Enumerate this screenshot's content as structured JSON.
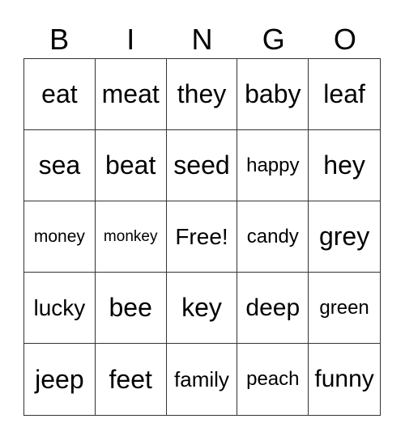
{
  "header": [
    "B",
    "I",
    "N",
    "G",
    "O"
  ],
  "cells": [
    "eat",
    "meat",
    "they",
    "baby",
    "leaf",
    "sea",
    "beat",
    "seed",
    "happy",
    "hey",
    "money",
    "monkey",
    "Free!",
    "candy",
    "grey",
    "lucky",
    "bee",
    "key",
    "deep",
    "green",
    "jeep",
    "feet",
    "family",
    "peach",
    "funny"
  ]
}
